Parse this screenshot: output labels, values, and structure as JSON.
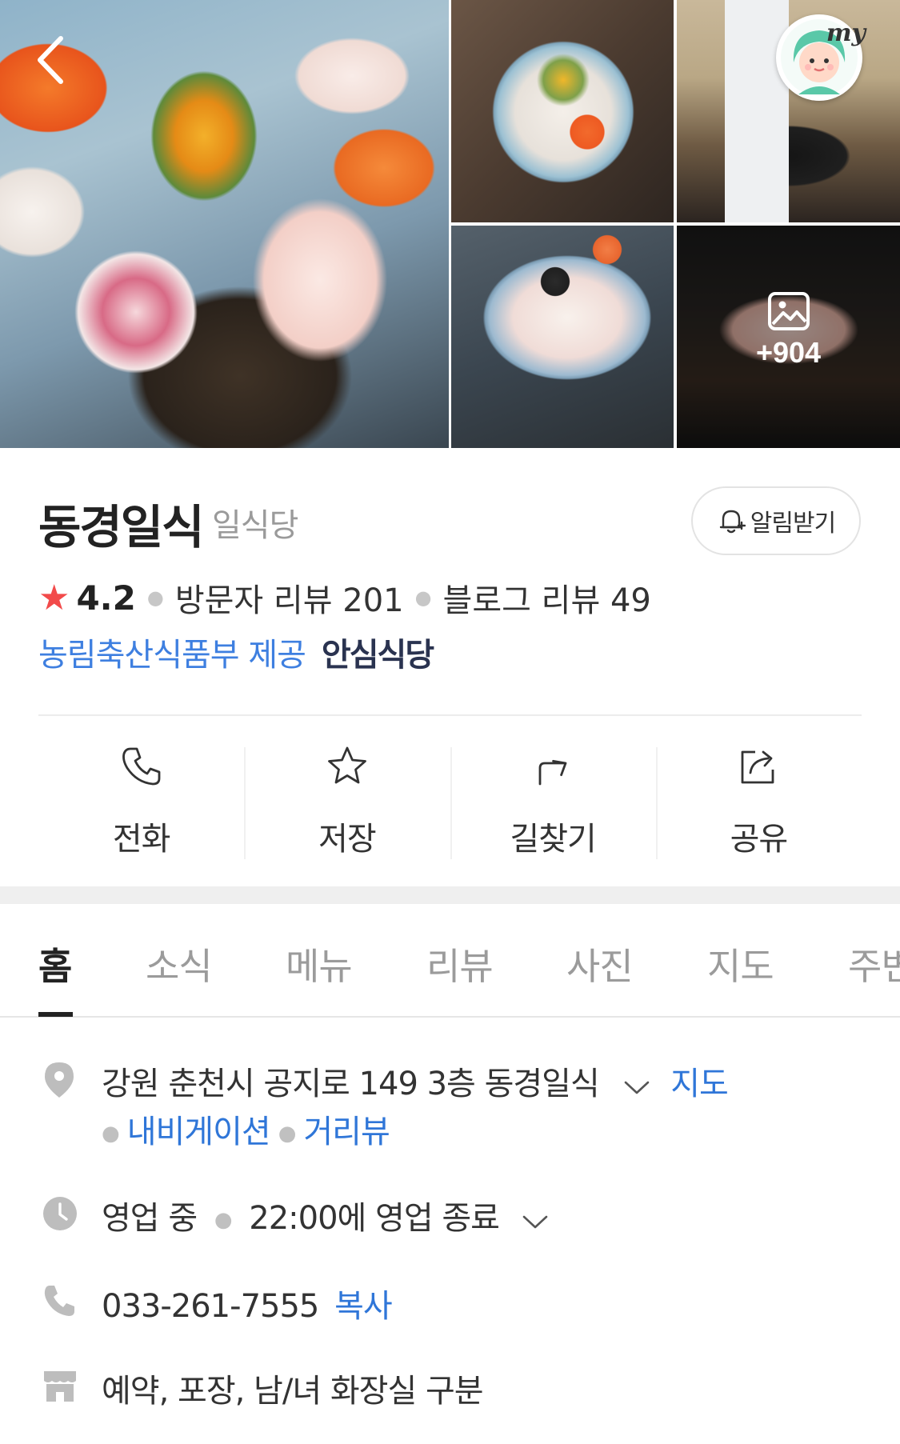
{
  "gallery": {
    "more_photos_count": "+904"
  },
  "place": {
    "name": "동경일식",
    "category": "일식당",
    "alarm_label": "알림받기",
    "rating": "4.2",
    "visitor_review_label": "방문자 리뷰 201",
    "blog_review_label": "블로그 리뷰 49",
    "certification_provider": "농림축산식품부 제공",
    "certification_mark": "안심식당"
  },
  "actions": [
    {
      "label": "전화",
      "icon": "phone-icon"
    },
    {
      "label": "저장",
      "icon": "star-icon"
    },
    {
      "label": "길찾기",
      "icon": "directions-icon"
    },
    {
      "label": "공유",
      "icon": "share-icon"
    }
  ],
  "tabs": [
    "홈",
    "소식",
    "메뉴",
    "리뷰",
    "사진",
    "지도",
    "주변"
  ],
  "active_tab": "홈",
  "info": {
    "address": "강원 춘천시 공지로 149 3층 동경일식",
    "map_link": "지도",
    "navigation_link": "내비게이션",
    "street_view_link": "거리뷰",
    "hours_status": "영업 중",
    "hours_detail": "22:00에 영업 종료",
    "phone": "033-261-7555",
    "copy_label": "복사",
    "amenities": "예약, 포장, 남/녀 화장실 구분"
  },
  "colors": {
    "link_blue": "#2f76d8",
    "cert_blue": "#3e7fe0",
    "star_red": "#f24a4a",
    "icon_gray": "#bdbdbd"
  }
}
